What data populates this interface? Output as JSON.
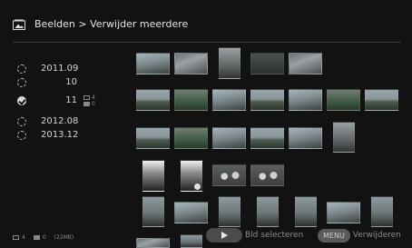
{
  "header": {
    "title": "Beelden > Verwijder meerdere",
    "icon": "image-folder-icon"
  },
  "dates": [
    {
      "label": "2011.09",
      "checked": false
    },
    {
      "label": "10",
      "checked": false
    },
    {
      "label": "11",
      "checked": true,
      "photos": "4",
      "videos": "0"
    },
    {
      "label": "2012.08",
      "checked": false
    },
    {
      "label": "2013.12",
      "checked": false
    }
  ],
  "footer": {
    "photo_count": "4",
    "video_count": "0",
    "size": "(22MB)",
    "select_label": "Bld selecteren",
    "menu_key": "MENU",
    "delete_label": "Verwijderen"
  }
}
